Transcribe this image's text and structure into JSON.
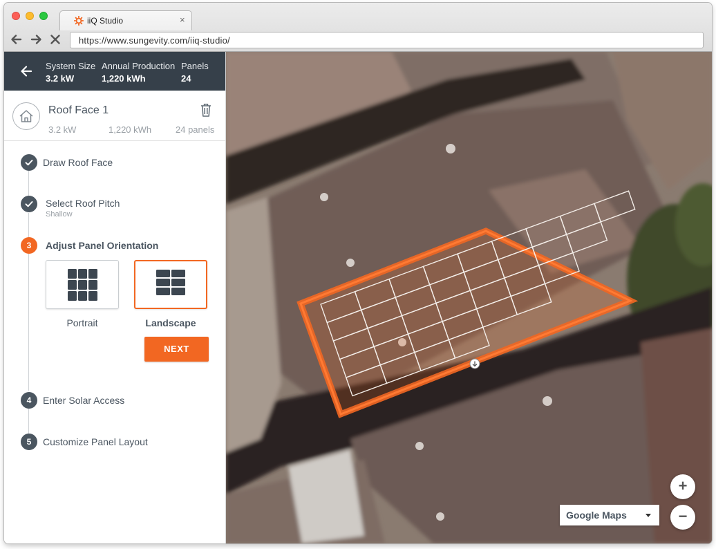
{
  "browser": {
    "tab_title": "iiQ Studio",
    "url": "https://www.sungevity.com/iiq-studio/",
    "tab_close": "×"
  },
  "summary": {
    "system_size_label": "System Size",
    "system_size_value": "3.2 kW",
    "annual_production_label": "Annual Production",
    "annual_production_value": "1,220 kWh",
    "panels_label": "Panels",
    "panels_value": "24"
  },
  "roof_face": {
    "title": "Roof Face 1",
    "size": "3.2 kW",
    "production": "1,220 kWh",
    "panels": "24 panels"
  },
  "steps": [
    {
      "number": "1",
      "label": "Draw Roof Face",
      "status": "complete"
    },
    {
      "number": "2",
      "label": "Select Roof Pitch",
      "sublabel": "Shallow",
      "status": "complete"
    },
    {
      "number": "3",
      "label": "Adjust Panel Orientation",
      "status": "active"
    },
    {
      "number": "4",
      "label": "Enter Solar Access",
      "status": "pending"
    },
    {
      "number": "5",
      "label": "Customize Panel Layout",
      "status": "pending"
    }
  ],
  "orientation": {
    "options": [
      "Portrait",
      "Landscape"
    ],
    "selected": "Landscape",
    "next_label": "NEXT"
  },
  "map": {
    "provider_label": "Google Maps",
    "zoom_in": "+",
    "zoom_out": "−"
  },
  "colors": {
    "accent": "#f26722",
    "header_bg": "#36404a",
    "step_complete": "#4b5660"
  },
  "icons": [
    "back-arrow-icon",
    "house-icon",
    "trash-icon",
    "checkmark-icon",
    "portrait-grid-icon",
    "landscape-grid-icon",
    "chevron-down-icon"
  ]
}
